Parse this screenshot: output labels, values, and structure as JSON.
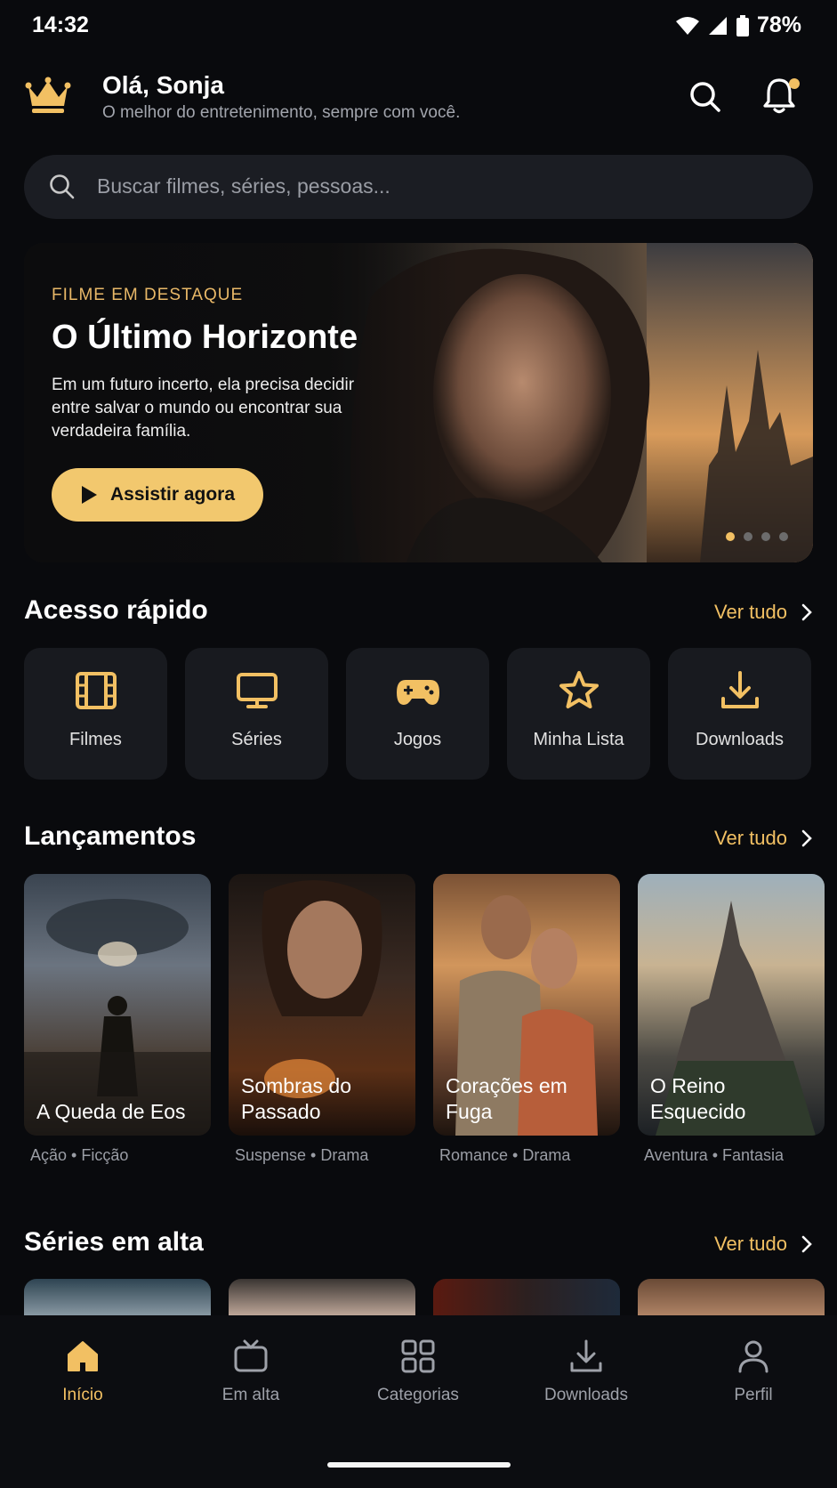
{
  "status_bar": {
    "time": "14:32",
    "battery": "78%"
  },
  "header": {
    "greeting": "Olá, Sonja",
    "tagline": "O melhor do entretenimento, sempre com você."
  },
  "search": {
    "placeholder": "Buscar filmes, séries, pessoas..."
  },
  "hero": {
    "eyebrow": "FILME EM DESTAQUE",
    "title": "O Último Horizonte",
    "description": "Em um futuro incerto, ela precisa decidir entre salvar o mundo ou encontrar sua verdadeira família.",
    "cta": "Assistir agora",
    "slide_count": 4,
    "active_slide": 1
  },
  "quick_access": {
    "title": "Acesso rápido",
    "see_all": "Ver tudo",
    "items": [
      {
        "label": "Filmes",
        "icon": "film-icon"
      },
      {
        "label": "Séries",
        "icon": "tv-icon"
      },
      {
        "label": "Jogos",
        "icon": "gamepad-icon"
      },
      {
        "label": "Minha Lista",
        "icon": "star-icon"
      },
      {
        "label": "Downloads",
        "icon": "download-icon"
      }
    ]
  },
  "releases": {
    "title": "Lançamentos",
    "see_all": "Ver tudo",
    "items": [
      {
        "title": "A Queda de Eos",
        "meta": "Ação • Ficção"
      },
      {
        "title": "Sombras do Passado",
        "meta": "Suspense • Drama"
      },
      {
        "title": "Corações em Fuga",
        "meta": "Romance • Drama"
      },
      {
        "title": "O Reino Esquecido",
        "meta": "Aventura • Fantasia"
      }
    ]
  },
  "trending_series": {
    "title": "Séries em alta",
    "see_all": "Ver tudo"
  },
  "tab_bar": {
    "tabs": [
      {
        "label": "Início",
        "icon": "home-icon",
        "active": true
      },
      {
        "label": "Em alta",
        "icon": "tv-icon",
        "active": false
      },
      {
        "label": "Categorias",
        "icon": "grid-icon",
        "active": false
      },
      {
        "label": "Downloads",
        "icon": "download-icon",
        "active": false
      },
      {
        "label": "Perfil",
        "icon": "user-icon",
        "active": false
      }
    ]
  },
  "colors": {
    "accent": "#f2c063",
    "background": "#090a0d",
    "card": "#181a1f"
  }
}
